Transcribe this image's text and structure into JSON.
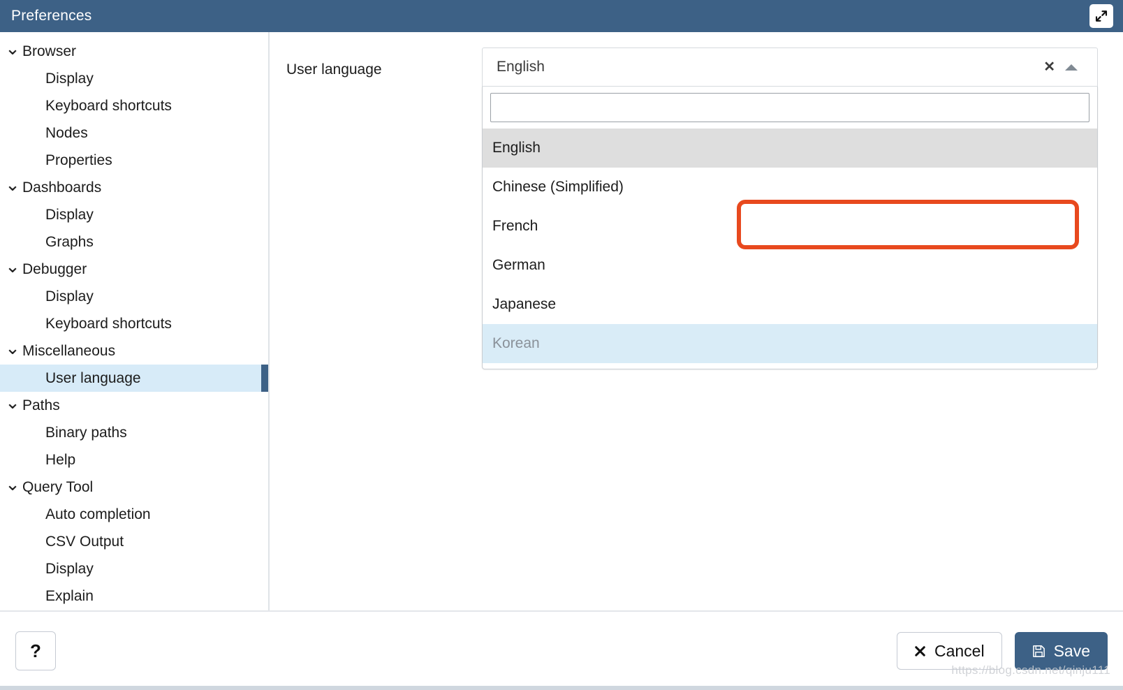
{
  "window": {
    "title": "Preferences",
    "titlebar_color": "#3d6186",
    "maximize_icon": "expand-arrows-icon"
  },
  "sidebar": {
    "items": [
      {
        "label": "Browser",
        "type": "group",
        "icon": "chevron-down-icon",
        "expanded": true,
        "selected": false
      },
      {
        "label": "Display",
        "type": "leaf",
        "selected": false
      },
      {
        "label": "Keyboard shortcuts",
        "type": "leaf",
        "selected": false
      },
      {
        "label": "Nodes",
        "type": "leaf",
        "selected": false
      },
      {
        "label": "Properties",
        "type": "leaf",
        "selected": false
      },
      {
        "label": "Dashboards",
        "type": "group",
        "icon": "chevron-down-icon",
        "expanded": true,
        "selected": false
      },
      {
        "label": "Display",
        "type": "leaf",
        "selected": false
      },
      {
        "label": "Graphs",
        "type": "leaf",
        "selected": false
      },
      {
        "label": "Debugger",
        "type": "group",
        "icon": "chevron-down-icon",
        "expanded": true,
        "selected": false
      },
      {
        "label": "Display",
        "type": "leaf",
        "selected": false
      },
      {
        "label": "Keyboard shortcuts",
        "type": "leaf",
        "selected": false
      },
      {
        "label": "Miscellaneous",
        "type": "group",
        "icon": "chevron-down-icon",
        "expanded": true,
        "selected": false
      },
      {
        "label": "User language",
        "type": "leaf",
        "selected": true
      },
      {
        "label": "Paths",
        "type": "group",
        "icon": "chevron-down-icon",
        "expanded": true,
        "selected": false
      },
      {
        "label": "Binary paths",
        "type": "leaf",
        "selected": false
      },
      {
        "label": "Help",
        "type": "leaf",
        "selected": false
      },
      {
        "label": "Query Tool",
        "type": "group",
        "icon": "chevron-down-icon",
        "expanded": true,
        "selected": false
      },
      {
        "label": "Auto completion",
        "type": "leaf",
        "selected": false
      },
      {
        "label": "CSV Output",
        "type": "leaf",
        "selected": false
      },
      {
        "label": "Display",
        "type": "leaf",
        "selected": false
      },
      {
        "label": "Explain",
        "type": "leaf",
        "selected": false
      }
    ],
    "selected_accent_color": "#3d6186",
    "selected_bg_color": "#d7ebf8"
  },
  "main": {
    "field_label": "User language",
    "select": {
      "value": "English",
      "clear_icon": "close-icon",
      "caret_icon": "caret-up-icon",
      "expanded": true
    },
    "dropdown": {
      "search_value": "",
      "search_placeholder": "",
      "options": [
        {
          "label": "English",
          "state": "selected"
        },
        {
          "label": "Chinese (Simplified)",
          "state": "normal"
        },
        {
          "label": "French",
          "state": "normal"
        },
        {
          "label": "German",
          "state": "normal"
        },
        {
          "label": "Japanese",
          "state": "normal"
        },
        {
          "label": "Korean",
          "state": "hovered"
        }
      ]
    }
  },
  "annotation": {
    "target_option": "Chinese (Simplified)",
    "color": "#e8491e",
    "shape": "rounded-rectangle"
  },
  "footer": {
    "help_label": "?",
    "help_icon": "question-mark-icon",
    "cancel_label": "Cancel",
    "cancel_icon": "close-icon",
    "save_label": "Save",
    "save_icon": "floppy-disk-icon",
    "save_color": "#3d6186"
  },
  "watermark": {
    "text": "https://blog.csdn.net/qinju111"
  }
}
